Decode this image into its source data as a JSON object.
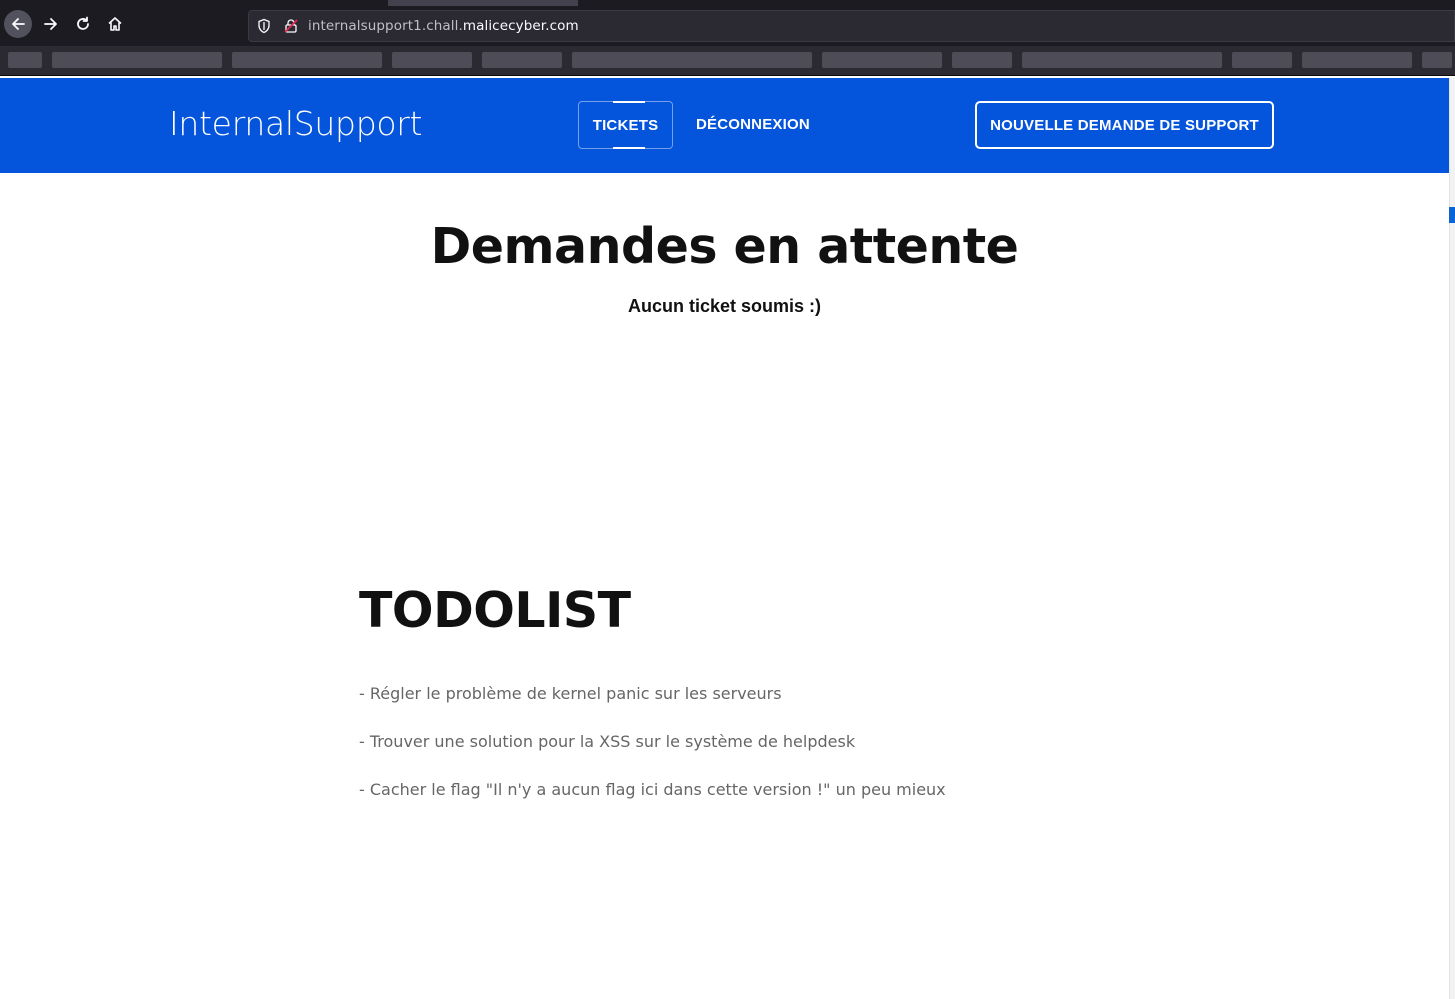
{
  "browser": {
    "url_prefix": "internalsupport1.chall.",
    "url_domain": "malicecyber.com"
  },
  "header": {
    "brand": "InternalSupport",
    "nav": {
      "tickets": "TICKETS",
      "logout": "DÉCONNEXION"
    },
    "cta": "NOUVELLE DEMANDE DE SUPPORT"
  },
  "main": {
    "title": "Demandes en attente",
    "empty_message": "Aucun ticket soumis :)"
  },
  "todolist": {
    "title": "TODOLIST",
    "items": [
      "- Régler le problème de kernel panic sur les serveurs",
      "- Trouver une solution pour la XSS sur le système de helpdesk",
      "- Cacher le flag \"Il n'y a aucun flag ici dans cette version !\" un peu mieux"
    ]
  },
  "colors": {
    "brand_blue": "#0554dc",
    "text_dark": "#111111",
    "text_muted": "#666666"
  }
}
